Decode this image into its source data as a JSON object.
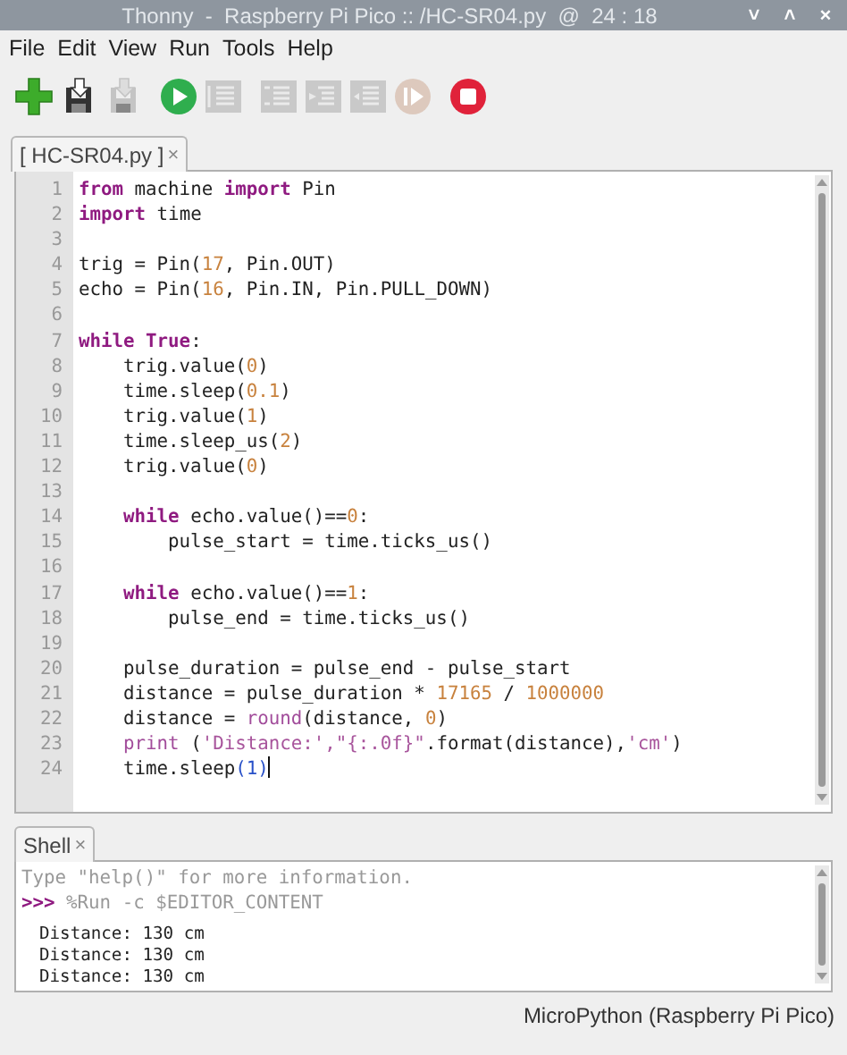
{
  "window": {
    "title": "Thonny  -  Raspberry Pi Pico :: /HC-SR04.py  @  24 : 18",
    "controls": [
      "˅",
      "˄",
      "×"
    ]
  },
  "menu": [
    "File",
    "Edit",
    "View",
    "Run",
    "Tools",
    "Help"
  ],
  "toolbar": [
    {
      "kind": "new",
      "disabled": false
    },
    {
      "kind": "save",
      "disabled": false
    },
    {
      "kind": "save",
      "disabled": true
    },
    {
      "kind": "run",
      "disabled": false
    },
    {
      "kind": "debug",
      "disabled": true
    },
    {
      "kind": "step_over",
      "disabled": true
    },
    {
      "kind": "step_into",
      "disabled": true
    },
    {
      "kind": "step_out",
      "disabled": true
    },
    {
      "kind": "resume",
      "disabled": true
    },
    {
      "kind": "stop",
      "disabled": false
    }
  ],
  "editor": {
    "tab": {
      "label": "[ HC-SR04.py ]",
      "close": "×",
      "selected": true
    },
    "lines": [
      {
        "number": "1",
        "cursor": false,
        "tokens": [
          {
            "kind": "kw",
            "text": "from"
          },
          {
            "kind": "plain",
            "text": " machine "
          },
          {
            "kind": "kw",
            "text": "import"
          },
          {
            "kind": "plain",
            "text": " Pin"
          }
        ]
      },
      {
        "number": "2",
        "cursor": false,
        "tokens": [
          {
            "kind": "kw",
            "text": "import"
          },
          {
            "kind": "plain",
            "text": " time"
          }
        ]
      },
      {
        "number": "3",
        "cursor": false
      },
      {
        "number": "4",
        "cursor": false,
        "tokens": [
          {
            "kind": "plain",
            "text": "trig = Pin("
          },
          {
            "kind": "num",
            "text": "17"
          },
          {
            "kind": "plain",
            "text": ", Pin.OUT)"
          }
        ]
      },
      {
        "number": "5",
        "cursor": false,
        "tokens": [
          {
            "kind": "plain",
            "text": "echo = Pin("
          },
          {
            "kind": "num",
            "text": "16"
          },
          {
            "kind": "plain",
            "text": ", Pin.IN, Pin.PULL_DOWN)"
          }
        ]
      },
      {
        "number": "6",
        "cursor": false
      },
      {
        "number": "7",
        "cursor": false,
        "tokens": [
          {
            "kind": "kw",
            "text": "while True"
          },
          {
            "kind": "plain",
            "text": ":"
          }
        ]
      },
      {
        "number": "8",
        "cursor": false,
        "tokens": [
          {
            "kind": "plain",
            "text": "    trig.value("
          },
          {
            "kind": "num",
            "text": "0"
          },
          {
            "kind": "plain",
            "text": ")"
          }
        ]
      },
      {
        "number": "9",
        "cursor": false,
        "tokens": [
          {
            "kind": "plain",
            "text": "    time.sleep("
          },
          {
            "kind": "num",
            "text": "0.1"
          },
          {
            "kind": "plain",
            "text": ")"
          }
        ]
      },
      {
        "number": "10",
        "cursor": false,
        "tokens": [
          {
            "kind": "plain",
            "text": "    trig.value("
          },
          {
            "kind": "num",
            "text": "1"
          },
          {
            "kind": "plain",
            "text": ")"
          }
        ]
      },
      {
        "number": "11",
        "cursor": false,
        "tokens": [
          {
            "kind": "plain",
            "text": "    time.sleep_us("
          },
          {
            "kind": "num",
            "text": "2"
          },
          {
            "kind": "plain",
            "text": ")"
          }
        ]
      },
      {
        "number": "12",
        "cursor": false,
        "tokens": [
          {
            "kind": "plain",
            "text": "    trig.value("
          },
          {
            "kind": "num",
            "text": "0"
          },
          {
            "kind": "plain",
            "text": ")"
          }
        ]
      },
      {
        "number": "13",
        "cursor": false
      },
      {
        "number": "14",
        "cursor": false,
        "tokens": [
          {
            "kind": "kw",
            "text": "    while"
          },
          {
            "kind": "plain",
            "text": " echo.value()=="
          },
          {
            "kind": "num",
            "text": "0"
          },
          {
            "kind": "plain",
            "text": ":"
          }
        ]
      },
      {
        "number": "15",
        "cursor": false,
        "tokens": [
          {
            "kind": "plain",
            "text": "        pulse_start = time.ticks_us()"
          }
        ]
      },
      {
        "number": "16",
        "cursor": false
      },
      {
        "number": "17",
        "cursor": false,
        "tokens": [
          {
            "kind": "kw",
            "text": "    while"
          },
          {
            "kind": "plain",
            "text": " echo.value()=="
          },
          {
            "kind": "num",
            "text": "1"
          },
          {
            "kind": "plain",
            "text": ":"
          }
        ]
      },
      {
        "number": "18",
        "cursor": false,
        "tokens": [
          {
            "kind": "plain",
            "text": "        pulse_end = time.ticks_us()"
          }
        ]
      },
      {
        "number": "19",
        "cursor": false
      },
      {
        "number": "20",
        "cursor": false,
        "tokens": [
          {
            "kind": "plain",
            "text": "    pulse_duration = pulse_end - pulse_start"
          }
        ]
      },
      {
        "number": "21",
        "cursor": false,
        "tokens": [
          {
            "kind": "plain",
            "text": "    distance = pulse_duration * "
          },
          {
            "kind": "num",
            "text": "17165"
          },
          {
            "kind": "plain",
            "text": " / "
          },
          {
            "kind": "num",
            "text": "1000000"
          }
        ]
      },
      {
        "number": "22",
        "cursor": false,
        "tokens": [
          {
            "kind": "plain",
            "text": "    distance = "
          },
          {
            "kind": "builtin",
            "text": "round"
          },
          {
            "kind": "plain",
            "text": "(distance, "
          },
          {
            "kind": "num",
            "text": "0"
          },
          {
            "kind": "plain",
            "text": ")"
          }
        ]
      },
      {
        "number": "23",
        "cursor": false,
        "tokens": [
          {
            "kind": "builtin",
            "text": "    print"
          },
          {
            "kind": "plain",
            "text": " ("
          },
          {
            "kind": "str",
            "text": "'Distance:',\"{:.0f}\""
          },
          {
            "kind": "plain",
            "text": ".format(distance),"
          },
          {
            "kind": "str",
            "text": "'cm'"
          },
          {
            "kind": "plain",
            "text": ")"
          }
        ]
      },
      {
        "number": "24",
        "cursor": true,
        "tokens": [
          {
            "kind": "plain",
            "text": "    time.sleep"
          },
          {
            "kind": "match",
            "text": "(1)"
          }
        ]
      }
    ]
  },
  "shell": {
    "tab": {
      "label": "Shell",
      "close": "×",
      "selected": true
    },
    "lines": [
      {
        "kind": "info",
        "text": "Type \"help()\" for more information."
      },
      {
        "kind": "command",
        "prompt": ">>>",
        "text": "%Run -c $EDITOR_CONTENT"
      },
      {
        "kind": "output",
        "text": "Distance: 130 cm"
      },
      {
        "kind": "output",
        "text": "Distance: 130 cm"
      },
      {
        "kind": "output",
        "text": "Distance: 130 cm"
      }
    ]
  },
  "status_bar": {
    "interpreter": "MicroPython (Raspberry Pi Pico)"
  }
}
